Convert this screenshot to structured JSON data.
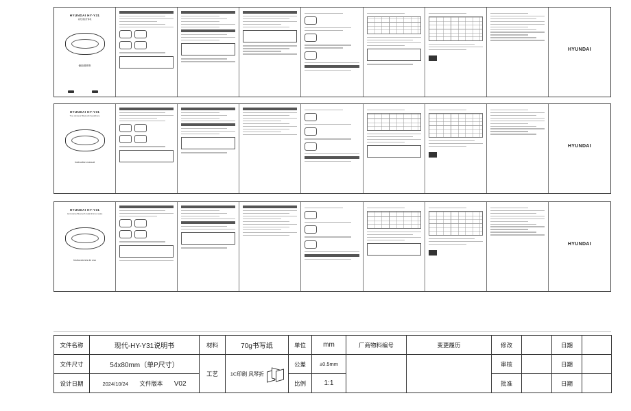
{
  "sheets": [
    {
      "brand_top": "HYUNDAI HY-Y31",
      "subtitle": "真无线蓝牙耳机",
      "manual_title": "使用说明书",
      "side_brand": "HYUNDAI"
    },
    {
      "brand_top": "HYUNDAI HY-Y31",
      "subtitle": "True wireless Bluetooth headphone",
      "manual_title": "Instruction manual",
      "side_brand": "HYUNDAI"
    },
    {
      "brand_top": "HYUNDAI HY-Y31",
      "subtitle": "Auriculares Bluetooth inalámbricos reales",
      "manual_title": "Instrucciones de uso",
      "side_brand": "HYUNDAI"
    }
  ],
  "spec": {
    "file_name_label": "文件名称",
    "file_name_value": "现代-HY-Y31说明书",
    "material_label": "材料",
    "material_value": "70g书写纸",
    "unit_label": "单位",
    "unit_value": "mm",
    "vendor_label": "厂商物料编号",
    "change_label": "变更履历",
    "revise_label": "修改",
    "date_label_1": "日期",
    "file_size_label": "文件尺寸",
    "file_size_value": "54x80mm（单P尺寸）",
    "process_label": "工艺",
    "tolerance_label": "公差",
    "tolerance_value": "±0.5mm",
    "review_label": "审核",
    "date_label_2": "日期",
    "design_date_label": "设计日期",
    "design_date_value": "2024/10/24",
    "version_label": "文件版本",
    "version_value": "V02",
    "process_value": "1C印刷 风琴折",
    "scale_label": "比例",
    "scale_value": "1:1",
    "approve_label": "批准",
    "date_label_3": "日期"
  }
}
